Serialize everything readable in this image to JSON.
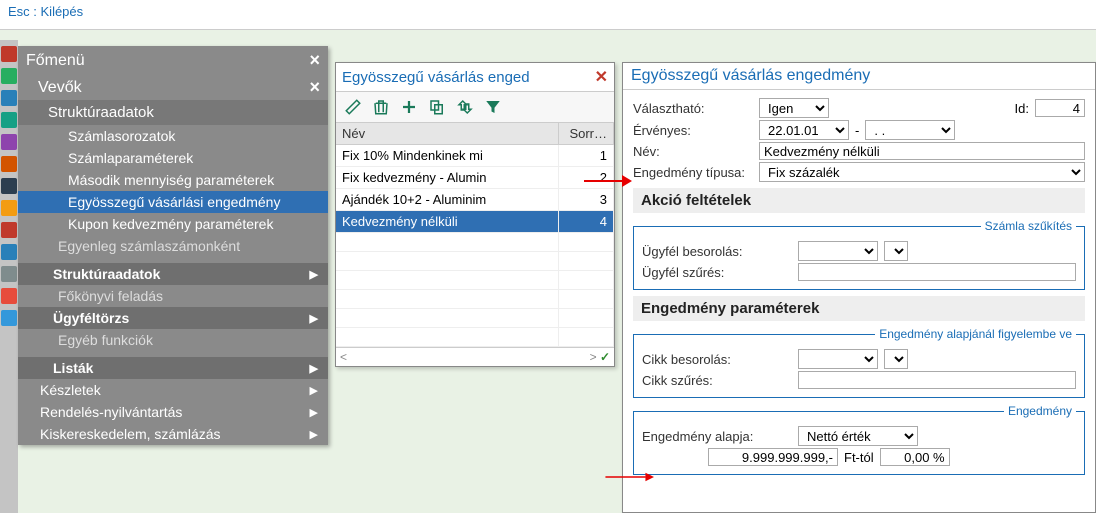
{
  "topbar": {
    "esc_label": "Esc : Kilépés"
  },
  "mainmenu": {
    "title": "Főmenü",
    "subtitle": "Vevők",
    "structdata": "Struktúraadatok",
    "items": {
      "szamlasor": "Számlasorozatok",
      "szamlapar": "Számlaparaméterek",
      "masodik": "Második mennyiség paraméterek",
      "egyossz": "Egyösszegű vásárlási engedmény",
      "kupon": "Kupon kedvezmény paraméterek"
    },
    "egyenleg": "Egyenleg számlaszámonként",
    "sections": {
      "structdata2": "Struktúraadatok",
      "fokonyvi": "Főkönyvi feladás",
      "ugyfeltorzs": "Ügyféltörzs",
      "egyeb": "Egyéb funkciók",
      "listak": "Listák"
    },
    "roots": {
      "keszletek": "Készletek",
      "rendeles": "Rendelés-nyilvántartás",
      "kisker": "Kiskereskedelem, számlázás"
    }
  },
  "listpanel": {
    "title": "Egyösszegű vásárlás enged",
    "cols": {
      "nev": "Név",
      "sorr": "Sorr…"
    },
    "rows": [
      {
        "nev": "Fix 10% Mindenkinek mi",
        "sorr": "1"
      },
      {
        "nev": "Fix kedvezmény - Alumin",
        "sorr": "2"
      },
      {
        "nev": "Ajándék 10+2 - Aluminim",
        "sorr": "3"
      },
      {
        "nev": "Kedvezmény nélküli",
        "sorr": "4"
      }
    ]
  },
  "formpanel": {
    "title": "Egyösszegű vásárlás engedmény",
    "valaszthato_lbl": "Választható:",
    "valaszthato_val": "Igen",
    "id_lbl": "Id:",
    "id_val": "4",
    "ervenyes_lbl": "Érvényes:",
    "ervenyes_from": "22.01.01",
    "ervenyes_to": ". .",
    "nev_lbl": "Név:",
    "nev_val": "Kedvezmény nélküli",
    "engtip_lbl": "Engedmény típusa:",
    "engtip_val": "Fix százalék",
    "akcio_hdr": "Akció feltételek",
    "szamla_szukites": "Számla szűkítés",
    "ugyfelbes_lbl": "Ügyfél besorolás:",
    "ugyfelszur_lbl": "Ügyfél szűrés:",
    "engparam_hdr": "Engedmény paraméterek",
    "engalapjanal": "Engedmény alapjánál figyelembe ve",
    "cikkbes_lbl": "Cikk besorolás:",
    "cikkszur_lbl": "Cikk szűrés:",
    "engedmeny_legend": "Engedmény",
    "engalapja_lbl": "Engedmény alapja:",
    "engalapja_val": "Nettó érték",
    "amount_val": "9.999.999.999,-",
    "fttol_lbl": "Ft-tól",
    "percent_val": "0,00 %"
  }
}
